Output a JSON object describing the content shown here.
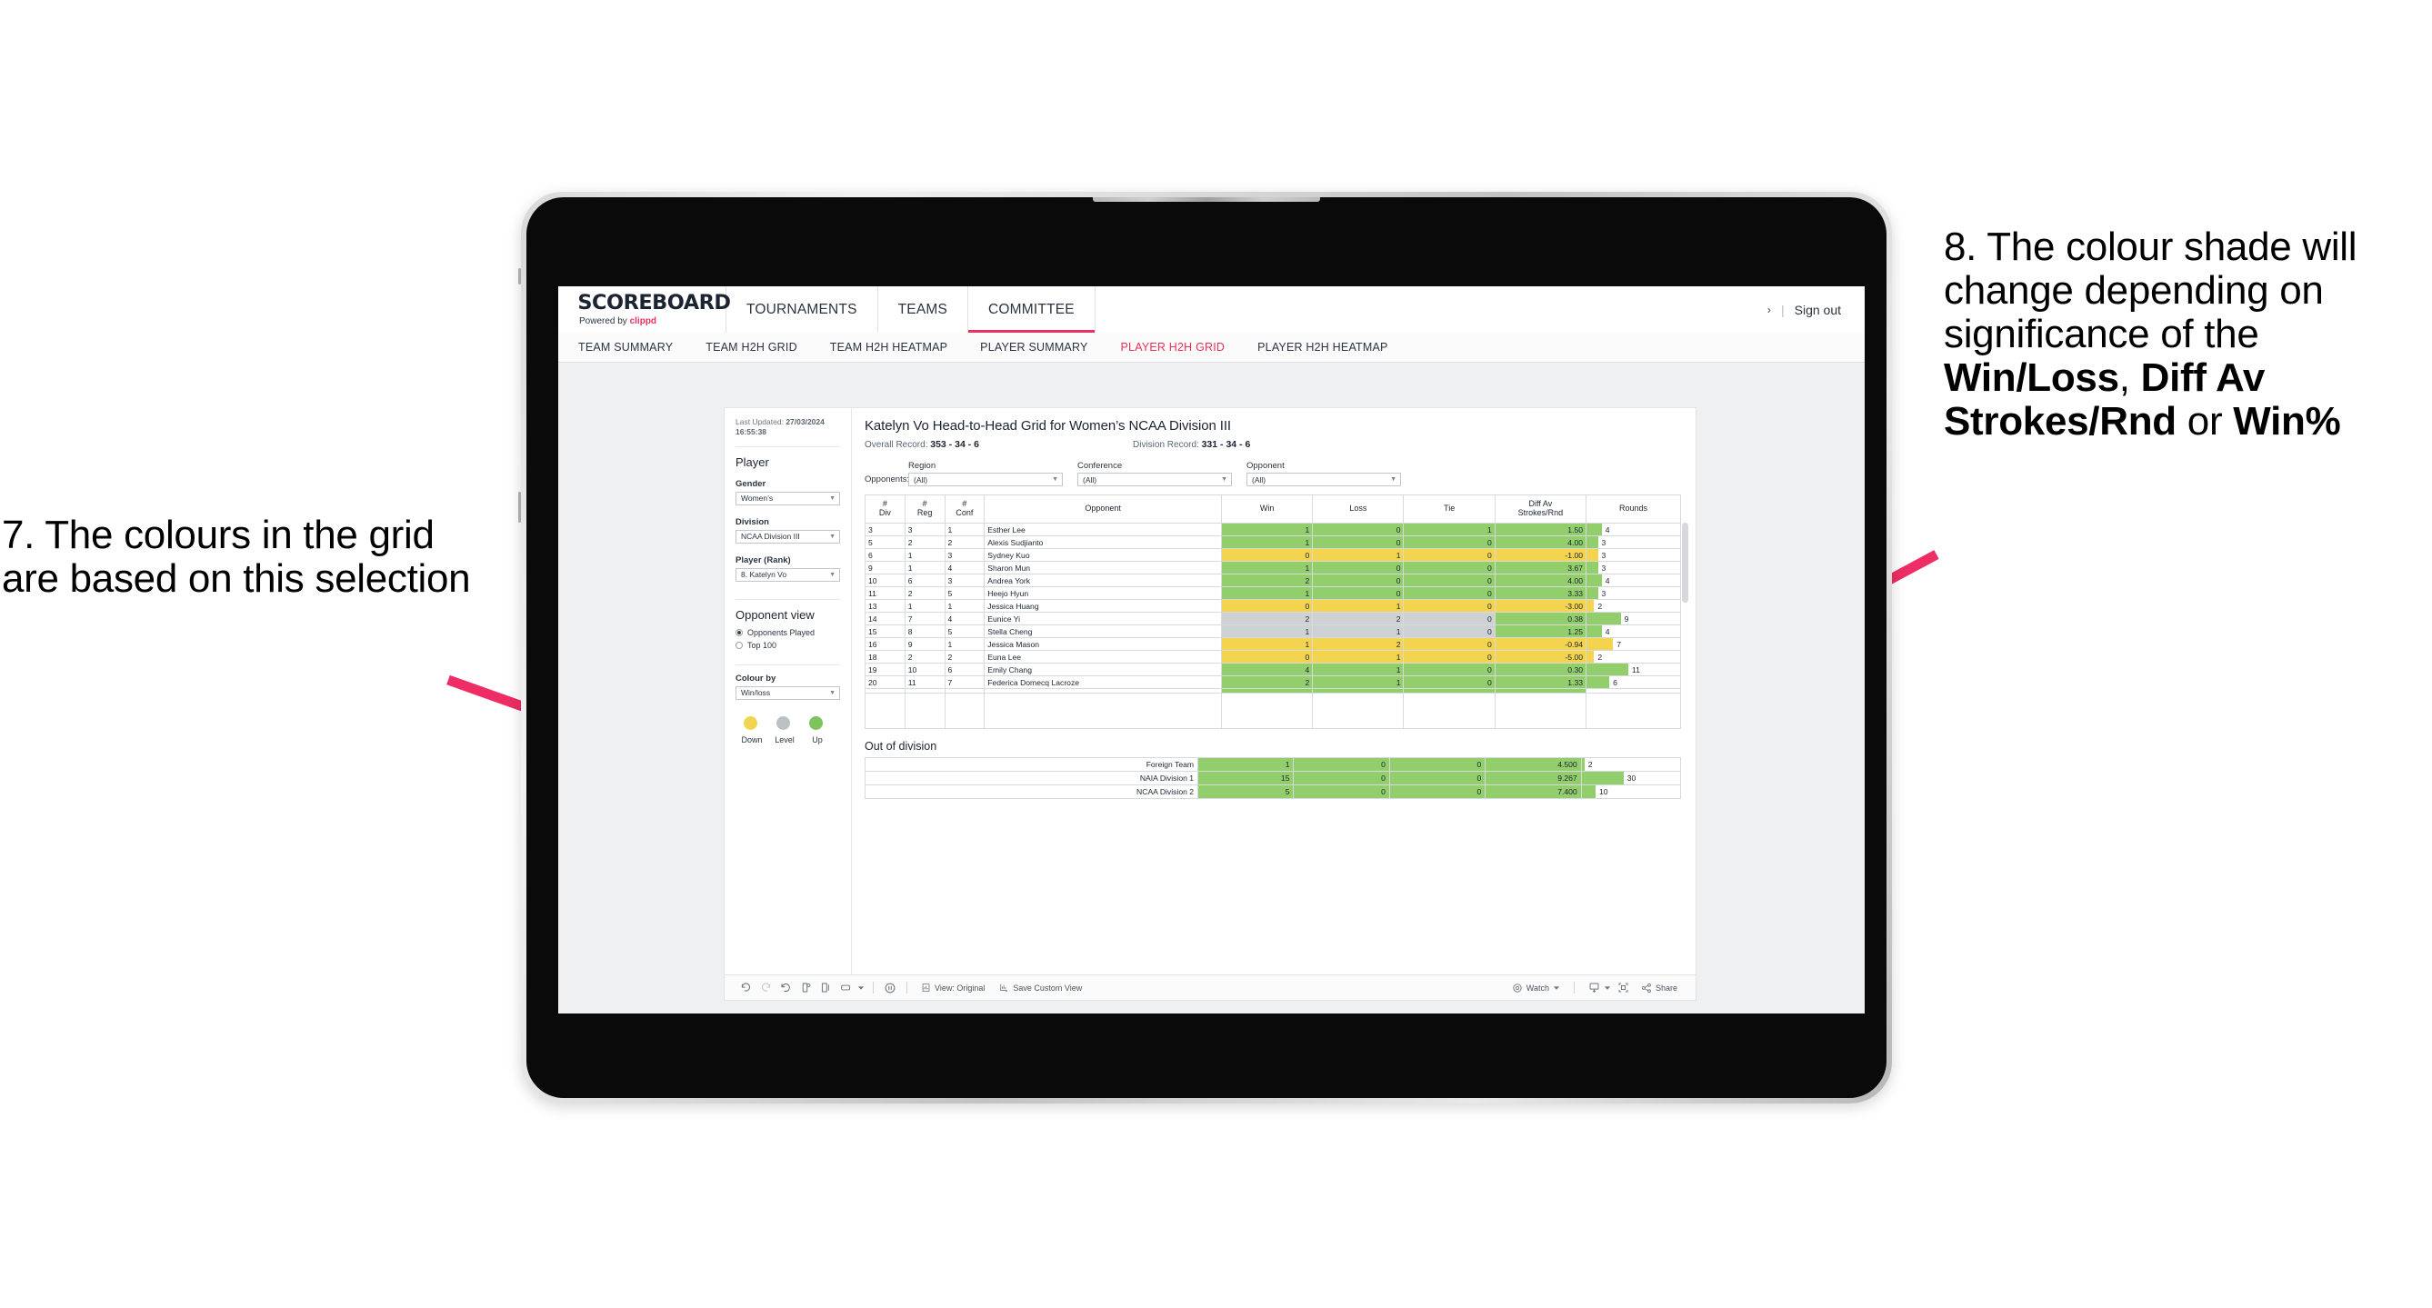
{
  "annotations": {
    "left": "7. The colours in the grid are based on this selection",
    "right_pre": "8. The colour shade will change depending on significance of the ",
    "right_b1": "Win/Loss",
    "right_mid1": ", ",
    "right_b2": "Diff Av Strokes/Rnd",
    "right_mid2": " or ",
    "right_b3": "Win%",
    "arrow_color": "#ED2D63"
  },
  "topnav": {
    "brand_word": "SCOREBOARD",
    "brand_sub_pre": "Powered by ",
    "brand_sub_brand": "clippd",
    "items": [
      {
        "label": "TOURNAMENTS",
        "active": false
      },
      {
        "label": "TEAMS",
        "active": false
      },
      {
        "label": "COMMITTEE",
        "active": true
      }
    ],
    "chevron": "›",
    "pipe": "|",
    "signout": "Sign out",
    "accent": "#E8315C"
  },
  "subnav": {
    "items": [
      {
        "label": "TEAM SUMMARY",
        "active": false
      },
      {
        "label": "TEAM H2H GRID",
        "active": false
      },
      {
        "label": "TEAM H2H HEATMAP",
        "active": false
      },
      {
        "label": "PLAYER SUMMARY",
        "active": false
      },
      {
        "label": "PLAYER H2H GRID",
        "active": true
      },
      {
        "label": "PLAYER H2H HEATMAP",
        "active": false
      }
    ]
  },
  "sidebar": {
    "last_updated_label": "Last Updated:",
    "last_updated_value": "27/03/2024 16:55:38",
    "player_heading": "Player",
    "gender_label": "Gender",
    "gender_value": "Women’s",
    "division_label": "Division",
    "division_value": "NCAA Division III",
    "player_rank_label": "Player (Rank)",
    "player_rank_value": "8. Katelyn Vo",
    "opponent_view_heading": "Opponent view",
    "opponent_view_options": [
      {
        "label": "Opponents Played",
        "selected": true
      },
      {
        "label": "Top 100",
        "selected": false
      }
    ],
    "colour_by_label": "Colour by",
    "colour_by_value": "Win/loss",
    "legend": [
      {
        "label": "Down",
        "color": "#F2D54E"
      },
      {
        "label": "Level",
        "color": "#BCC1C6"
      },
      {
        "label": "Up",
        "color": "#7DC35E"
      }
    ]
  },
  "viz": {
    "title": "Katelyn Vo Head-to-Head Grid for Women’s NCAA Division III",
    "overall_record_label": "Overall Record:",
    "overall_record_value": "353 -  34 - 6",
    "division_record_label": "Division Record:",
    "division_record_value": "331 -  34 - 6",
    "opponents_label": "Opponents:",
    "opponent_filters": [
      {
        "title": "Region",
        "value": "(All)"
      },
      {
        "title": "Conference",
        "value": "(All)"
      },
      {
        "title": "Opponent",
        "value": "(All)"
      }
    ],
    "out_of_division_title": "Out of division"
  },
  "chart_data": {
    "type": "table",
    "title": "Katelyn Vo Head-to-Head Grid for Women’s NCAA Division III",
    "columns": [
      "# Div",
      "# Reg",
      "# Conf",
      "Opponent",
      "Win",
      "Loss",
      "Tie",
      "Diff Av Strokes/Rnd",
      "Rounds"
    ],
    "column_headers_multiline": [
      [
        "#",
        "Div"
      ],
      [
        "#",
        "Reg"
      ],
      [
        "#",
        "Conf"
      ],
      [
        "Opponent"
      ],
      [
        "Win"
      ],
      [
        "Loss"
      ],
      [
        "Tie"
      ],
      [
        "Diff Av",
        "Strokes/Rnd"
      ],
      [
        "Rounds"
      ]
    ],
    "rounds_max": 11,
    "rows": [
      {
        "div": "3",
        "reg": "3",
        "conf": "1",
        "opponent": "Esther Lee",
        "win": "1",
        "loss": "0",
        "tie": "1",
        "diff": "1.50",
        "rounds": "4",
        "shade": "up"
      },
      {
        "div": "5",
        "reg": "2",
        "conf": "2",
        "opponent": "Alexis Sudjianto",
        "win": "1",
        "loss": "0",
        "tie": "0",
        "diff": "4.00",
        "rounds": "3",
        "shade": "up"
      },
      {
        "div": "6",
        "reg": "1",
        "conf": "3",
        "opponent": "Sydney Kuo",
        "win": "0",
        "loss": "1",
        "tie": "0",
        "diff": "-1.00",
        "rounds": "3",
        "shade": "down"
      },
      {
        "div": "9",
        "reg": "1",
        "conf": "4",
        "opponent": "Sharon Mun",
        "win": "1",
        "loss": "0",
        "tie": "0",
        "diff": "3.67",
        "rounds": "3",
        "shade": "up"
      },
      {
        "div": "10",
        "reg": "6",
        "conf": "3",
        "opponent": "Andrea York",
        "win": "2",
        "loss": "0",
        "tie": "0",
        "diff": "4.00",
        "rounds": "4",
        "shade": "up"
      },
      {
        "div": "11",
        "reg": "2",
        "conf": "5",
        "opponent": "Heejo Hyun",
        "win": "1",
        "loss": "0",
        "tie": "0",
        "diff": "3.33",
        "rounds": "3",
        "shade": "up"
      },
      {
        "div": "13",
        "reg": "1",
        "conf": "1",
        "opponent": "Jessica Huang",
        "win": "0",
        "loss": "1",
        "tie": "0",
        "diff": "-3.00",
        "rounds": "2",
        "shade": "down"
      },
      {
        "div": "14",
        "reg": "7",
        "conf": "4",
        "opponent": "Eunice Yi",
        "win": "2",
        "loss": "2",
        "tie": "0",
        "diff": "0.38",
        "rounds": "9",
        "shade": "level",
        "diff_shade": "up"
      },
      {
        "div": "15",
        "reg": "8",
        "conf": "5",
        "opponent": "Stella Cheng",
        "win": "1",
        "loss": "1",
        "tie": "0",
        "diff": "1.25",
        "rounds": "4",
        "shade": "level",
        "diff_shade": "up"
      },
      {
        "div": "16",
        "reg": "9",
        "conf": "1",
        "opponent": "Jessica Mason",
        "win": "1",
        "loss": "2",
        "tie": "0",
        "diff": "-0.94",
        "rounds": "7",
        "shade": "down"
      },
      {
        "div": "18",
        "reg": "2",
        "conf": "2",
        "opponent": "Euna Lee",
        "win": "0",
        "loss": "1",
        "tie": "0",
        "diff": "-5.00",
        "rounds": "2",
        "shade": "down"
      },
      {
        "div": "19",
        "reg": "10",
        "conf": "6",
        "opponent": "Emily Chang",
        "win": "4",
        "loss": "1",
        "tie": "0",
        "diff": "0.30",
        "rounds": "11",
        "shade": "up"
      },
      {
        "div": "20",
        "reg": "11",
        "conf": "7",
        "opponent": "Federica Domecq Lacroze",
        "win": "2",
        "loss": "1",
        "tie": "0",
        "diff": "1.33",
        "rounds": "6",
        "shade": "up"
      }
    ],
    "out_of_division": {
      "rounds_max": 30,
      "rows": [
        {
          "name": "Foreign Team",
          "win": "1",
          "loss": "0",
          "tie": "0",
          "diff": "4.500",
          "rounds": "2",
          "shade": "up"
        },
        {
          "name": "NAIA Division 1",
          "win": "15",
          "loss": "0",
          "tie": "0",
          "diff": "9.267",
          "rounds": "30",
          "shade": "up"
        },
        {
          "name": "NCAA Division 2",
          "win": "5",
          "loss": "0",
          "tie": "0",
          "diff": "7.400",
          "rounds": "10",
          "shade": "up"
        }
      ]
    },
    "colors": {
      "up": "#92CE6B",
      "down": "#F4D34E",
      "level": "#CFD2D5",
      "blank": "#FFFFFF"
    }
  },
  "toolbar": {
    "view_label": "View: Original",
    "save_label": "Save Custom View",
    "watch_label": "Watch",
    "share_label": "Share"
  }
}
